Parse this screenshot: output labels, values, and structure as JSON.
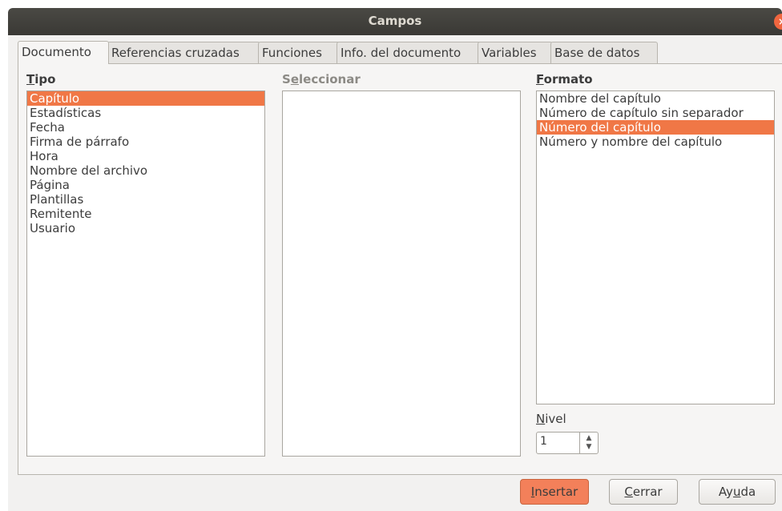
{
  "window": {
    "title": "Campos",
    "close_glyph": "×"
  },
  "tabs": [
    {
      "label": "Documento",
      "active": true
    },
    {
      "label": "Referencias cruzadas"
    },
    {
      "label": "Funciones"
    },
    {
      "label": "Info. del documento"
    },
    {
      "label": "Variables"
    },
    {
      "label": "Base de datos"
    }
  ],
  "tipo": {
    "label_first": "T",
    "label_rest": "ipo",
    "items": [
      "Capítulo",
      "Estadísticas",
      "Fecha",
      "Firma de párrafo",
      "Hora",
      "Nombre del archivo",
      "Página",
      "Plantillas",
      "Remitente",
      "Usuario"
    ],
    "selected_index": 0
  },
  "seleccionar": {
    "label_first": "S",
    "label_underlined": "e",
    "label_rest": "leccionar"
  },
  "formato": {
    "label_first": "F",
    "label_rest": "ormato",
    "items": [
      "Nombre del capítulo",
      "Número de capítulo sin separador",
      "Número del capítulo",
      "Número y nombre del capítulo"
    ],
    "selected_index": 2
  },
  "nivel": {
    "label_first": "N",
    "label_rest": "ivel",
    "value": "1",
    "up_glyph": "▲",
    "down_glyph": "▼"
  },
  "buttons": {
    "insertar": {
      "u": "I",
      "rest": "nsertar"
    },
    "cerrar": {
      "u": "C",
      "rest": "errar"
    },
    "ayuda": {
      "pre": "Ay",
      "u": "u",
      "rest": "da"
    }
  },
  "colors": {
    "accent": "#f07746",
    "titlebar": "#3e3d39",
    "dialog": "#f2f1f0"
  }
}
